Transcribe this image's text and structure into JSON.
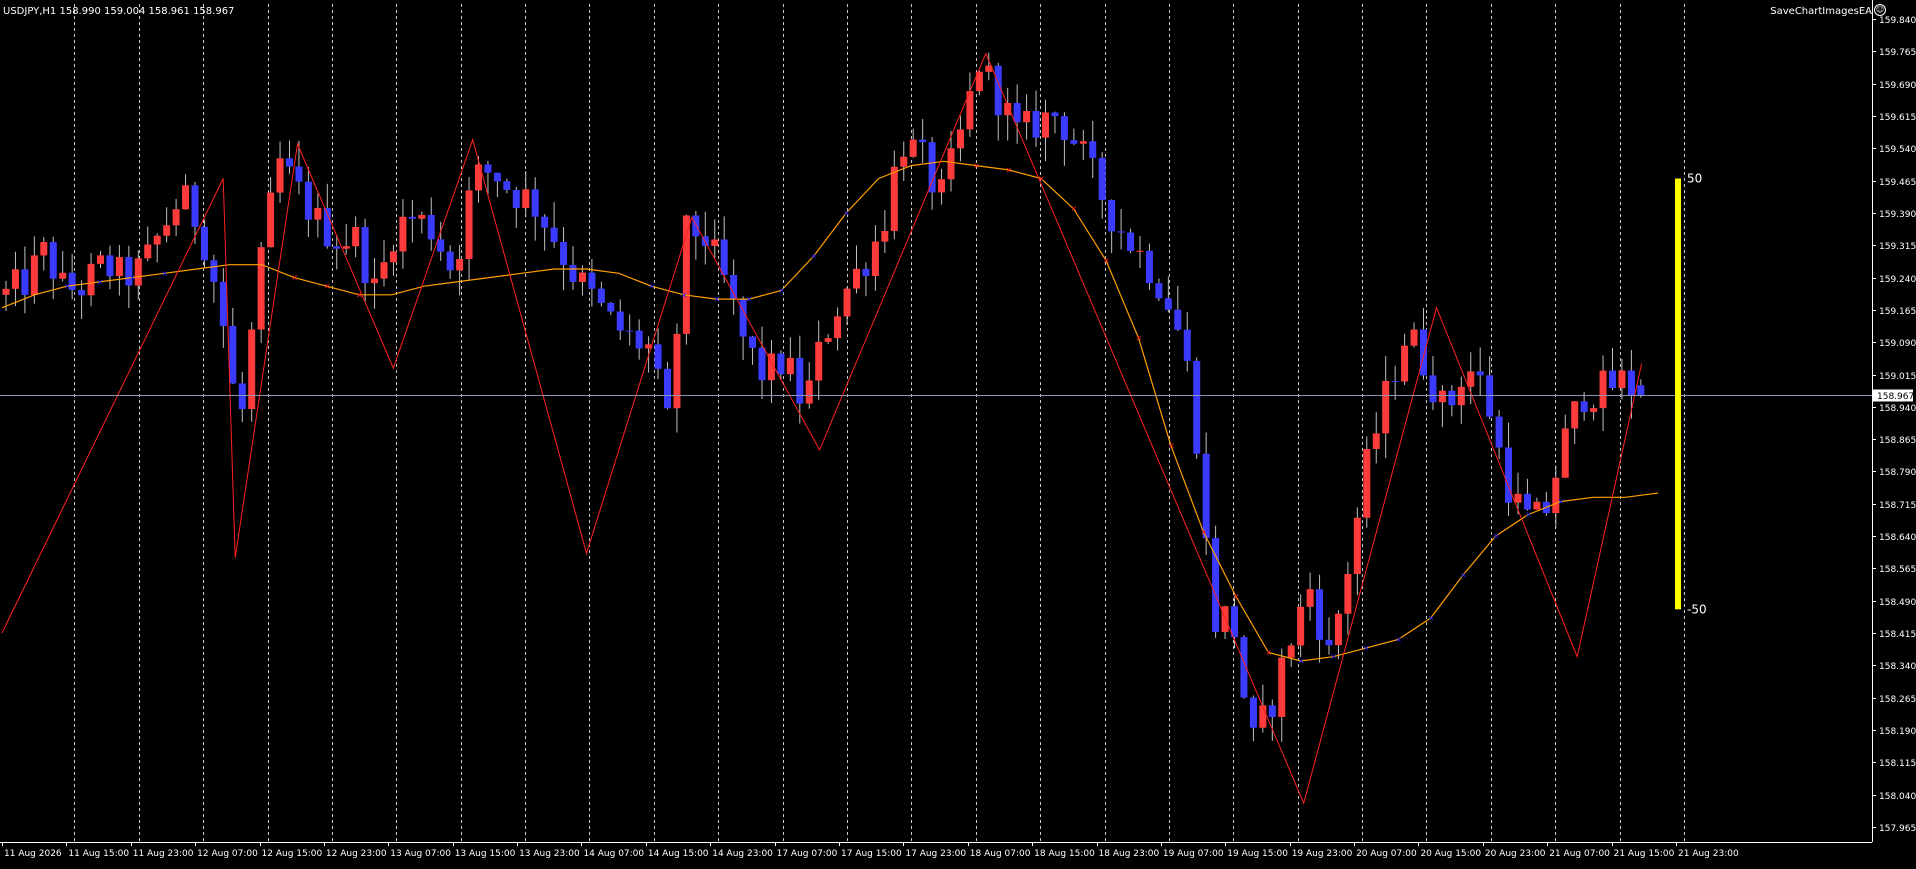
{
  "header": {
    "symbol_info": "USDJPY,H1  158.990 159.004 158.961 158.967",
    "ea_name": "SaveChartImagesEA"
  },
  "colors": {
    "background": "#000000",
    "bull_candle": "#ff3b3b",
    "bear_candle": "#3b3bff",
    "wick": "#c0c0c0",
    "zigzag": "#ff2020",
    "moving_average": "#ffa000",
    "arrow_up": "#2020ff",
    "arrow_down": "#ff2020",
    "separator": "#c8c8c8",
    "current_price_line": "#8c96b4",
    "indicator_bar": "#ffff00"
  },
  "icons": {
    "ea_status": "smiley-icon"
  },
  "chart_data": {
    "type": "candlestick",
    "symbol": "USDJPY",
    "timeframe": "H1",
    "ohlc_current": {
      "open": 158.99,
      "high": 159.004,
      "low": 158.961,
      "close": 158.967
    },
    "current_price_label": "158.967",
    "current_price": 158.967,
    "ylim": [
      157.93,
      159.875
    ],
    "y_ticks": [
      "159.840",
      "159.765",
      "159.690",
      "159.615",
      "159.540",
      "159.465",
      "159.390",
      "159.315",
      "159.240",
      "159.165",
      "159.090",
      "159.015",
      "158.940",
      "158.865",
      "158.790",
      "158.715",
      "158.640",
      "158.565",
      "158.490",
      "158.415",
      "158.340",
      "158.265",
      "158.190",
      "158.115",
      "158.040",
      "157.965"
    ],
    "x_tick_labels": [
      "11 Aug 2026",
      "11 Aug 15:00",
      "11 Aug 23:00",
      "12 Aug 07:00",
      "12 Aug 15:00",
      "12 Aug 23:00",
      "13 Aug 07:00",
      "13 Aug 15:00",
      "13 Aug 23:00",
      "14 Aug 07:00",
      "14 Aug 15:00",
      "14 Aug 23:00",
      "17 Aug 07:00",
      "17 Aug 15:00",
      "17 Aug 23:00",
      "18 Aug 07:00",
      "18 Aug 15:00",
      "18 Aug 23:00",
      "19 Aug 07:00",
      "19 Aug 15:00",
      "19 Aug 23:00",
      "20 Aug 07:00",
      "20 Aug 15:00",
      "20 Aug 23:00",
      "21 Aug 07:00",
      "21 Aug 15:00",
      "21 Aug 23:00"
    ],
    "close_path": [
      159.2,
      159.23,
      159.3,
      159.21,
      159.22,
      159.27,
      159.24,
      159.26,
      159.35,
      159.43,
      159.36,
      159.18,
      158.88,
      159.24,
      159.51,
      159.44,
      159.37,
      159.33,
      159.33,
      159.2,
      159.36,
      159.38,
      159.35,
      159.25,
      159.47,
      159.49,
      159.44,
      159.42,
      159.35,
      159.26,
      159.2,
      159.14,
      159.1,
      159.08,
      158.9,
      159.36,
      159.33,
      159.22,
      159.08,
      159.01,
      159.05,
      158.94,
      159.1,
      159.2,
      159.27,
      159.35,
      159.56,
      159.52,
      159.42,
      159.56,
      159.74,
      159.66,
      159.57,
      159.6,
      159.62,
      159.55,
      159.46,
      159.37,
      159.31,
      159.25,
      159.16,
      158.97,
      158.44,
      158.46,
      158.15,
      158.25,
      158.4,
      158.52,
      158.36,
      158.58,
      158.82,
      158.98,
      159.12,
      159.03,
      158.92,
      159.04,
      158.98,
      158.78,
      158.68,
      158.68,
      158.85,
      158.97,
      158.98,
      159.0,
      158.97
    ],
    "zigzag_points": [
      {
        "x": "11 Aug 2026",
        "y": 158.415
      },
      {
        "x": "12 Aug 07:00",
        "y": 159.47
      },
      {
        "x": "12 Aug 07:00",
        "y": 158.59
      },
      {
        "x": "12 Aug 15:00",
        "y": 159.55
      },
      {
        "x": "13 Aug 07:00",
        "y": 159.03
      },
      {
        "x": "13 Aug 15:00",
        "y": 159.56
      },
      {
        "x": "14 Aug 07:00",
        "y": 158.6
      },
      {
        "x": "14 Aug 15:00",
        "y": 159.38
      },
      {
        "x": "17 Aug 07:00",
        "y": 158.84
      },
      {
        "x": "18 Aug 07:00",
        "y": 159.76
      },
      {
        "x": "19 Aug 23:00",
        "y": 158.02
      },
      {
        "x": "20 Aug 15:00",
        "y": 159.17
      },
      {
        "x": "21 Aug 07:00",
        "y": 158.36
      },
      {
        "x": "21 Aug 15:00",
        "y": 159.04
      }
    ],
    "moving_average_path": [
      159.17,
      159.2,
      159.22,
      159.23,
      159.24,
      159.25,
      159.26,
      159.27,
      159.27,
      159.24,
      159.22,
      159.2,
      159.2,
      159.22,
      159.23,
      159.24,
      159.25,
      159.26,
      159.26,
      159.25,
      159.22,
      159.2,
      159.19,
      159.19,
      159.21,
      159.29,
      159.39,
      159.47,
      159.5,
      159.51,
      159.5,
      159.49,
      159.47,
      159.4,
      159.28,
      159.1,
      158.85,
      158.65,
      158.5,
      158.37,
      158.35,
      158.36,
      158.38,
      158.4,
      158.45,
      158.55,
      158.64,
      158.69,
      158.72,
      158.73,
      158.73,
      158.74
    ],
    "grid": false,
    "indicator_bar": {
      "label_top": "50",
      "label_bottom": "-50",
      "top": 50,
      "bottom": -50
    }
  }
}
